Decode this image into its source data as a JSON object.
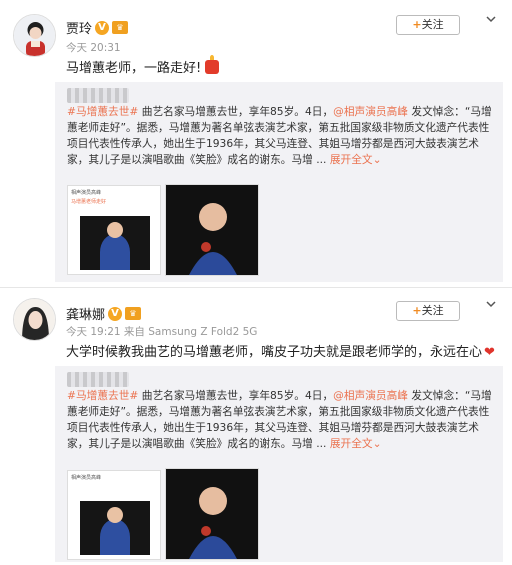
{
  "posts": [
    {
      "author": "贾玲",
      "verified": "V",
      "meta": "今天 20:31",
      "follow_label": "关注",
      "text": "马增蕙老师，一路走好!",
      "repost": {
        "tag": "#马增蕙去世#",
        "body_a": " 曲艺名家马增蕙去世，享年85岁。4日，",
        "mention": "@相声演员高峰",
        "body_b": " 发文悼念：“马增蕙老师走好”。据悉，马增蕙为著名单弦表演艺术家，第五批国家级非物质文化遗产代表性项目代表性传承人，她出生于1936年，其父马连登、其姐马增芬都是西河大鼓表演艺术家，其儿子是以演唱歌曲《笑脸》成名的谢东。马增 ...",
        "more": "展开全文",
        "thumb_caption_1": "相声演员高峰",
        "thumb_caption_2": "马增蕙老师走好"
      }
    },
    {
      "author": "龚琳娜",
      "verified": "V",
      "meta": "今天 19:21 来自 Samsung Z Fold2 5G",
      "follow_label": "关注",
      "text": "大学时候教我曲艺的马增蕙老师，嘴皮子功夫就是跟老师学的，永远在心",
      "repost": {
        "tag": "#马增蕙去世#",
        "body_a": " 曲艺名家马增蕙去世，享年85岁。4日，",
        "mention": "@相声演员高峰",
        "body_b": " 发文悼念：“马增蕙老师走好”。据悉，马增蕙为著名单弦表演艺术家，第五批国家级非物质文化遗产代表性项目代表性传承人，她出生于1936年，其父马连登、其姐马增芬都是西河大鼓表演艺术家，其儿子是以演唱歌曲《笑脸》成名的谢东。马增 ...",
        "more": "展开全文",
        "thumb_caption_1": "相声演员高峰",
        "thumb_caption_2": ""
      }
    }
  ],
  "icons": {
    "follow": "plus-icon",
    "menu": "chevron-down-icon",
    "candle": "candle-emoji",
    "heart": "heart-emoji"
  },
  "colors": {
    "accent": "#eb7350",
    "badge": "#f5a623",
    "heart": "#e0342c"
  }
}
